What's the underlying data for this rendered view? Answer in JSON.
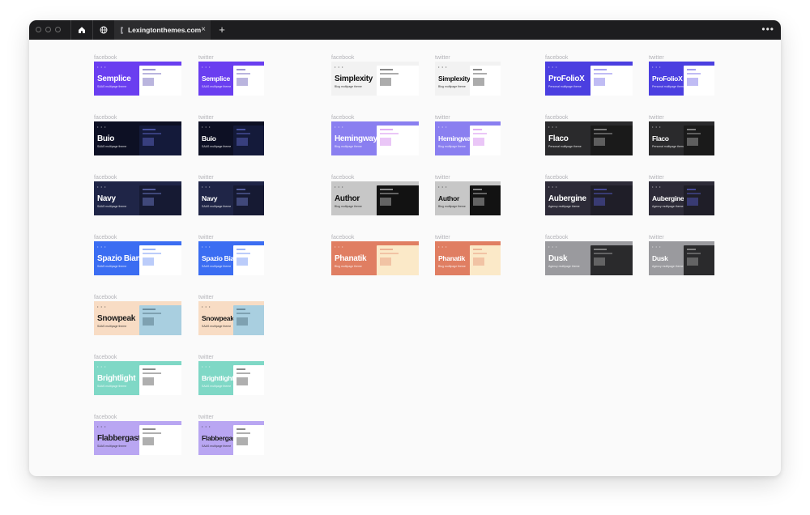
{
  "browser": {
    "tab_title": "Lexingtonthemes.com",
    "tab_close": "×",
    "new_tab": "+",
    "more": "•••"
  },
  "labels": {
    "facebook": "facebook",
    "twitter": "twitter"
  },
  "themes": [
    {
      "name": "Semplice",
      "sub": "SAAS multipage theme",
      "bg": "#6a3ef0",
      "fg": "#ffffff",
      "shot": "#ffffff",
      "ink": "#3a2aa0"
    },
    {
      "name": "Buio",
      "sub": "SAAS multipage theme",
      "bg": "#0d1024",
      "fg": "#ffffff",
      "shot": "#141a3a",
      "ink": "#7a86ff"
    },
    {
      "name": "Navy",
      "sub": "SAAS multipage theme",
      "bg": "#1f2547",
      "fg": "#ffffff",
      "shot": "#161a33",
      "ink": "#8fa0ff"
    },
    {
      "name": "Spazio Bianco",
      "sub": "SAAS multipage theme",
      "bg": "#3b6df2",
      "fg": "#ffffff",
      "shot": "#ffffff",
      "ink": "#3b6df2"
    },
    {
      "name": "Snowpeak",
      "sub": "SAAS multipage theme",
      "bg": "#f8dcc4",
      "fg": "#1a1a1a",
      "shot": "#a9cfe0",
      "ink": "#2f4b5a"
    },
    {
      "name": "Brightlight",
      "sub": "SAAS multipage theme",
      "bg": "#7fd8c6",
      "fg": "#ffffff",
      "shot": "#ffffff",
      "ink": "#1b1b1b"
    },
    {
      "name": "Flabbergasted",
      "sub": "SAAS multipage theme",
      "bg": "#b9a6f2",
      "fg": "#1a1a1a",
      "shot": "#ffffff",
      "ink": "#1a1a1a"
    },
    {
      "name": "Simplexity",
      "sub": "Blog multipage theme",
      "bg": "#f2f2f2",
      "fg": "#111111",
      "shot": "#ffffff",
      "ink": "#111111"
    },
    {
      "name": "Hemingway",
      "sub": "Blog multipage theme",
      "bg": "#8a7ff0",
      "fg": "#ffffff",
      "shot": "#ffffff",
      "ink": "#c45de8"
    },
    {
      "name": "Author",
      "sub": "Blog multipage theme",
      "bg": "#c7c7c7",
      "fg": "#111111",
      "shot": "#121212",
      "ink": "#ffffff"
    },
    {
      "name": "Phanatik",
      "sub": "Blog multipage theme",
      "bg": "#e07e62",
      "fg": "#ffffff",
      "shot": "#fbe9c8",
      "ink": "#e07e62"
    },
    {
      "name": "ProFolioX",
      "sub": "Personal multipage theme",
      "bg": "#4b3fe0",
      "fg": "#ffffff",
      "shot": "#ffffff",
      "ink": "#4b3fe0"
    },
    {
      "name": "Flaco",
      "sub": "Personal multipage theme",
      "bg": "#2a2a2c",
      "fg": "#ffffff",
      "shot": "#1a1a1a",
      "ink": "#e0e0e0"
    },
    {
      "name": "Aubergine",
      "sub": "Agency multipage theme",
      "bg": "#2d2b38",
      "fg": "#ffffff",
      "shot": "#1f1e28",
      "ink": "#6b72ff"
    },
    {
      "name": "Dusk",
      "sub": "Agency multipage theme",
      "bg": "#9a9a9e",
      "fg": "#ffffff",
      "shot": "#2a2a2c",
      "ink": "#cfcfcf"
    }
  ]
}
